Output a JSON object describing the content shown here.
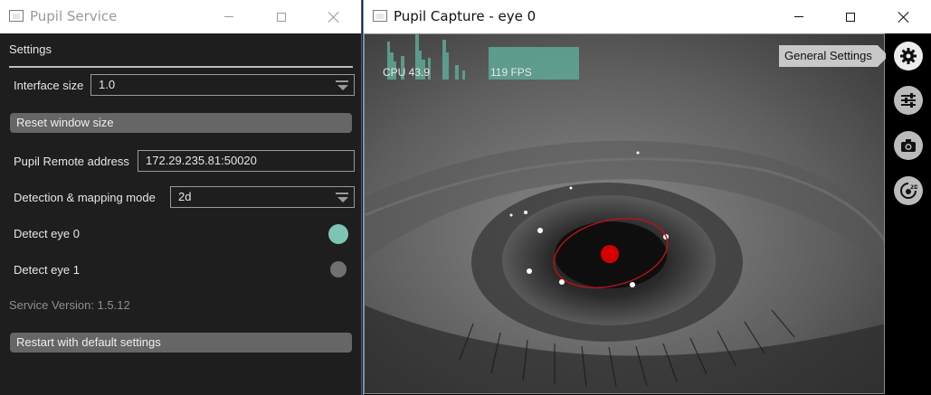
{
  "service_window": {
    "title": "Pupil Service",
    "settings": {
      "header": "Settings",
      "interface_size": {
        "label": "Interface size",
        "value": "1.0"
      },
      "reset_window_size": "Reset window size",
      "pupil_remote": {
        "label": "Pupil Remote address",
        "value": "172.29.235.81:50020"
      },
      "detection_mode": {
        "label": "Detection & mapping mode",
        "value": "2d"
      },
      "detect_eye0": {
        "label": "Detect eye 0",
        "enabled": true,
        "color": "#7ec4b4"
      },
      "detect_eye1": {
        "label": "Detect eye 1",
        "enabled": false,
        "color": "#707070"
      },
      "version": "Service Version: 1.5.12",
      "restart_default": "Restart with default settings"
    }
  },
  "capture_window": {
    "title": "Pupil Capture - eye 0",
    "cpu_label": "CPU 43.9",
    "fps_label": "119 FPS",
    "tooltip": "General Settings",
    "sidebar_icons": [
      "gear-icon",
      "list-icon",
      "camera-icon",
      "eye-2d-icon"
    ],
    "pupil_ellipse_color": "#b0141a",
    "pupil_center_color": "#d40000"
  },
  "colors": {
    "graph_fill": "#5fa896",
    "accent_eye0": "#7ec4b4"
  }
}
